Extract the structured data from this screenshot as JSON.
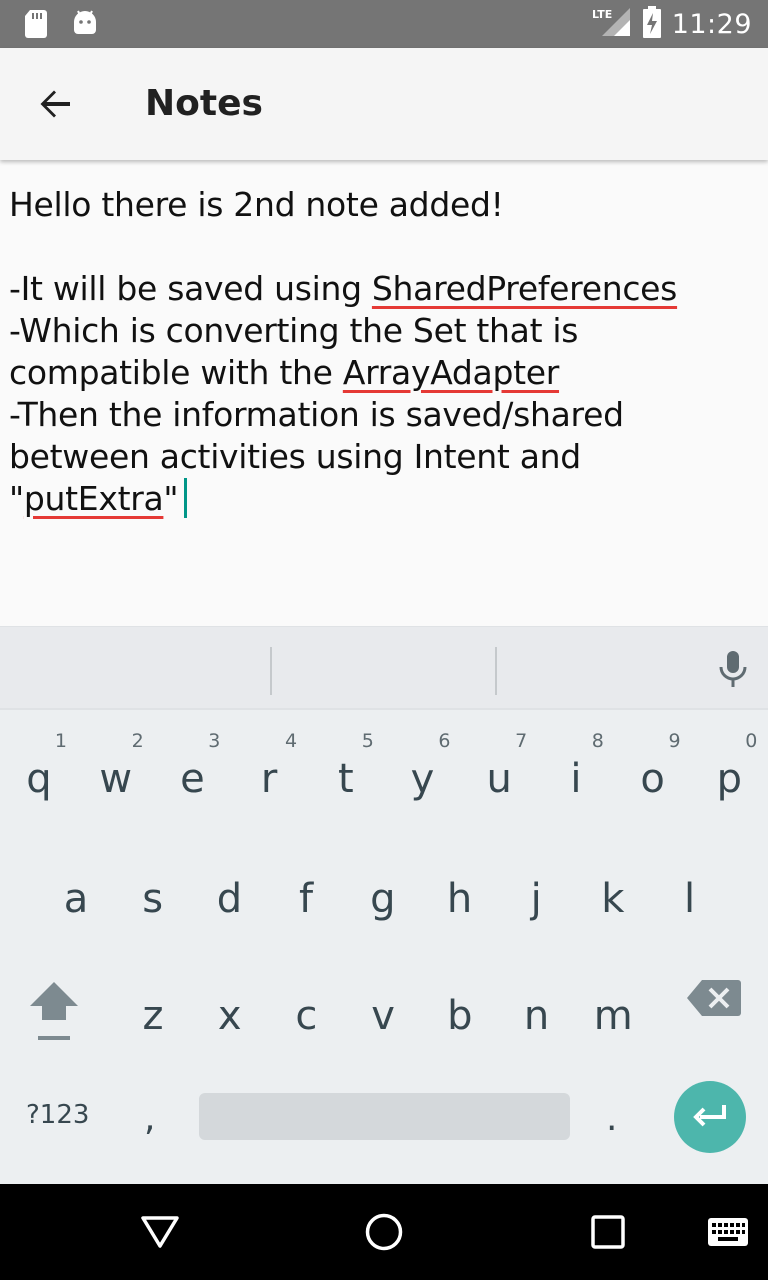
{
  "status_bar": {
    "time": "11:29",
    "network": "LTE",
    "icons": [
      "sd-card-icon",
      "android-icon",
      "lte-signal-icon",
      "battery-charging-icon"
    ]
  },
  "toolbar": {
    "back_icon": "arrow-back-icon",
    "title": "Notes"
  },
  "editor": {
    "line1": "Hello there is 2nd note added!",
    "line2a": "-It will be saved using ",
    "line2b": "SharedPreferences",
    "line3": "-Which is converting the Set that is",
    "line4a": "compatible with the ",
    "line4b": "ArrayAdapter",
    "line5": "-Then the information is saved/shared",
    "line6": "between activities using Intent and",
    "line7a": "\"",
    "line7b": "putExtra",
    "line7c": "\"",
    "accent_color": "#009688",
    "spell_error_color": "#e53935"
  },
  "keyboard": {
    "row1": [
      {
        "key": "q",
        "hint": "1"
      },
      {
        "key": "w",
        "hint": "2"
      },
      {
        "key": "e",
        "hint": "3"
      },
      {
        "key": "r",
        "hint": "4"
      },
      {
        "key": "t",
        "hint": "5"
      },
      {
        "key": "y",
        "hint": "6"
      },
      {
        "key": "u",
        "hint": "7"
      },
      {
        "key": "i",
        "hint": "8"
      },
      {
        "key": "o",
        "hint": "9"
      },
      {
        "key": "p",
        "hint": "0"
      }
    ],
    "row2": [
      "a",
      "s",
      "d",
      "f",
      "g",
      "h",
      "j",
      "k",
      "l"
    ],
    "row3": [
      "z",
      "x",
      "c",
      "v",
      "b",
      "n",
      "m"
    ],
    "symbols_label": "?123",
    "comma": ",",
    "period": ".",
    "enter_color": "#4db6ac"
  },
  "nav_bar": {
    "icons": [
      "back-triangle-icon",
      "home-circle-icon",
      "recents-square-icon",
      "keyboard-switch-icon"
    ]
  }
}
